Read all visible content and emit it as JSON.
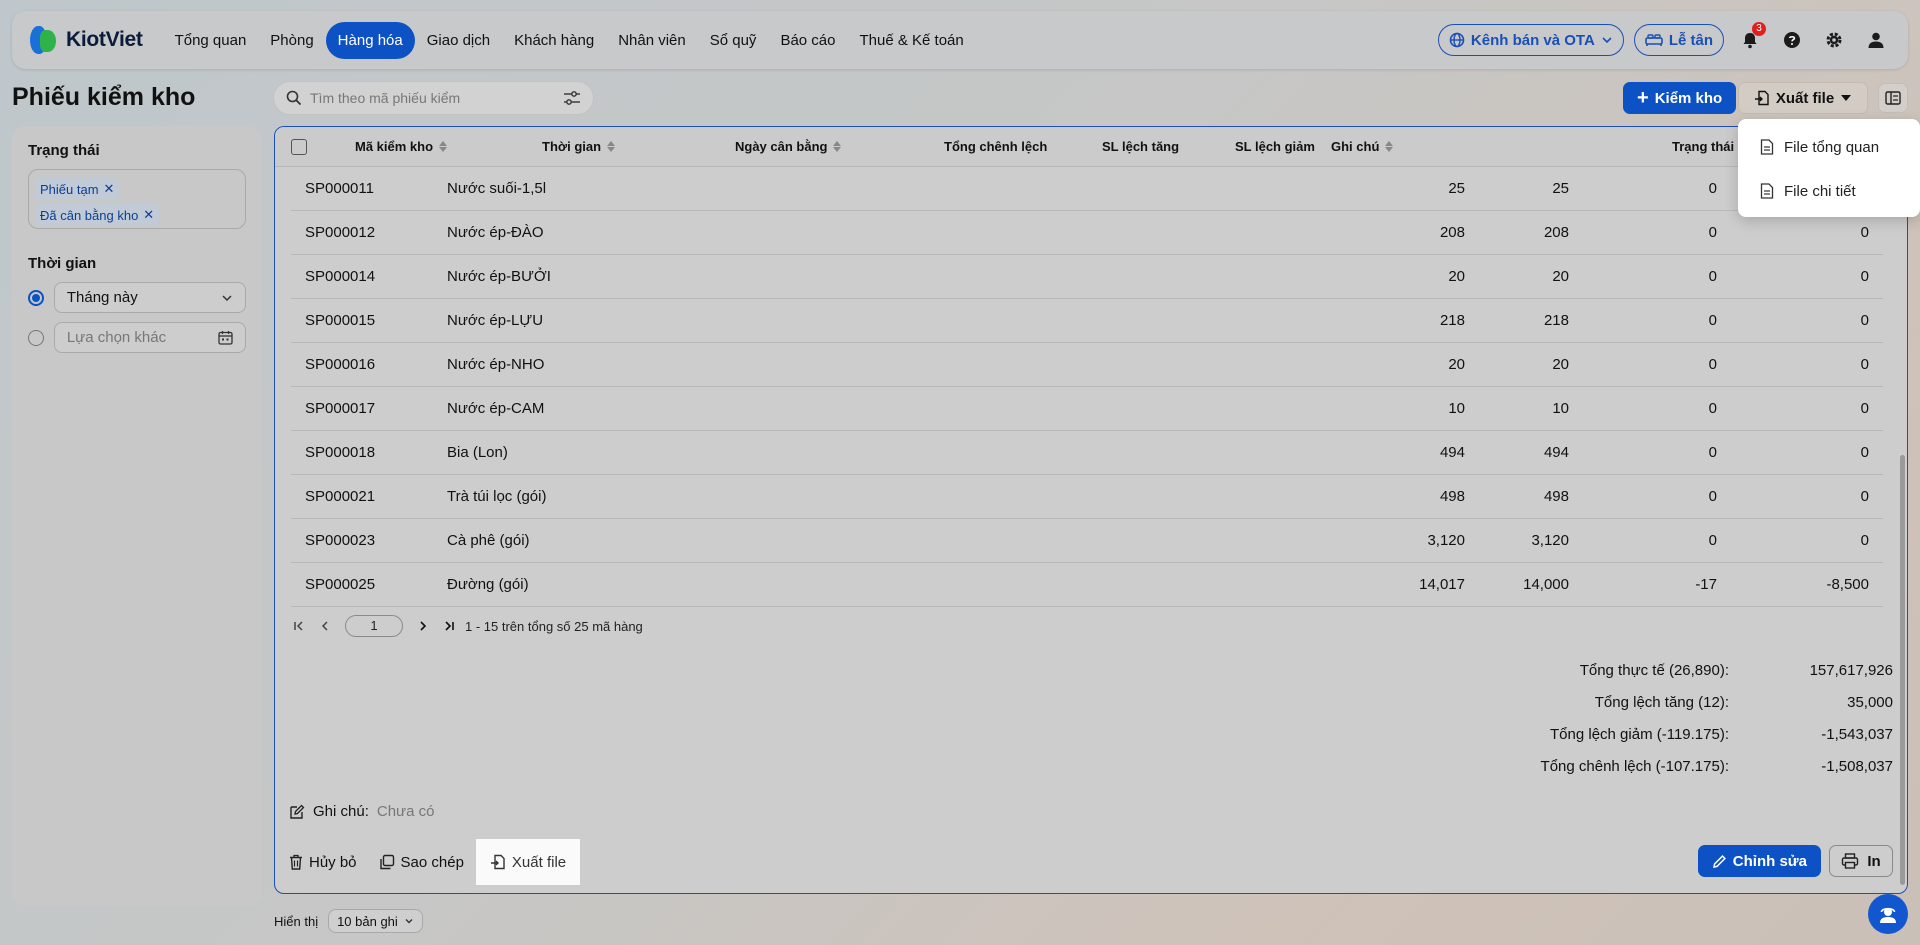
{
  "nav": {
    "brand": "KiotViet",
    "items": [
      "Tổng quan",
      "Phòng",
      "Hàng hóa",
      "Giao dịch",
      "Khách hàng",
      "Nhân viên",
      "Sổ quỹ",
      "Báo cáo",
      "Thuế & Kế toán"
    ],
    "active_index": 2,
    "channel_button": "Kênh bán và OTA",
    "reception_button": "Lễ tân",
    "notification_count": "3"
  },
  "page": {
    "title": "Phiếu kiểm kho",
    "search_placeholder": "Tìm theo mã phiếu kiểm",
    "add_button": "Kiểm kho",
    "export_button": "Xuất file"
  },
  "export_menu": [
    "File tổng quan",
    "File chi tiết"
  ],
  "sidebar": {
    "status_label": "Trạng thái",
    "status_tags": [
      "Phiếu tạm",
      "Đã cân bằng kho"
    ],
    "time_label": "Thời gian",
    "time_option_selected": "Tháng này",
    "time_option_custom_placeholder": "Lựa chọn khác"
  },
  "table": {
    "headers": [
      "Mã kiểm kho",
      "Thời gian",
      "Ngày cân bằng",
      "Tổng chênh lệch",
      "SL lệch tăng",
      "SL lệch giảm",
      "Ghi chú",
      "Trạng thái"
    ],
    "rows": [
      {
        "code": "SP000011",
        "name": "Nước suối-1,5l",
        "a": "25",
        "b": "25",
        "c": "0",
        "d": ""
      },
      {
        "code": "SP000012",
        "name": "Nước ép-ĐÀO",
        "a": "208",
        "b": "208",
        "c": "0",
        "d": "0"
      },
      {
        "code": "SP000014",
        "name": "Nước ép-BƯỞI",
        "a": "20",
        "b": "20",
        "c": "0",
        "d": "0"
      },
      {
        "code": "SP000015",
        "name": "Nước ép-LỰU",
        "a": "218",
        "b": "218",
        "c": "0",
        "d": "0"
      },
      {
        "code": "SP000016",
        "name": "Nước ép-NHO",
        "a": "20",
        "b": "20",
        "c": "0",
        "d": "0"
      },
      {
        "code": "SP000017",
        "name": "Nước ép-CAM",
        "a": "10",
        "b": "10",
        "c": "0",
        "d": "0"
      },
      {
        "code": "SP000018",
        "name": "Bia (Lon)",
        "a": "494",
        "b": "494",
        "c": "0",
        "d": "0"
      },
      {
        "code": "SP000021",
        "name": "Trà túi lọc (gói)",
        "a": "498",
        "b": "498",
        "c": "0",
        "d": "0"
      },
      {
        "code": "SP000023",
        "name": "Cà phê (gói)",
        "a": "3,120",
        "b": "3,120",
        "c": "0",
        "d": "0"
      },
      {
        "code": "SP000025",
        "name": "Đường (gói)",
        "a": "14,017",
        "b": "14,000",
        "c": "-17",
        "d": "-8,500"
      }
    ],
    "pager_page": "1",
    "pager_text": "1 - 15 trên tổng số 25 mã hàng"
  },
  "totals": [
    {
      "label": "Tổng thực tế (26,890):",
      "value": "157,617,926"
    },
    {
      "label": "Tổng lệch tăng (12):",
      "value": "35,000"
    },
    {
      "label": "Tổng lệch giảm (-119.175):",
      "value": "-1,543,037"
    },
    {
      "label": "Tổng chênh lệch (-107.175):",
      "value": "-1,508,037"
    }
  ],
  "note": {
    "label": "Ghi chú:",
    "value": "Chưa có"
  },
  "actions": {
    "cancel": "Hủy bỏ",
    "copy": "Sao chép",
    "export": "Xuất file",
    "edit": "Chỉnh sửa",
    "print": "In"
  },
  "footer": {
    "show_label": "Hiển thị",
    "page_size": "10 bản ghi"
  },
  "colors": {
    "primary": "#0c52c4",
    "badge": "#e0201f"
  }
}
